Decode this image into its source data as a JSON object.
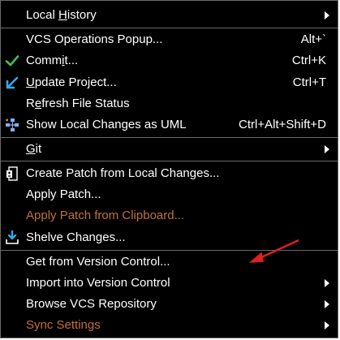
{
  "menu": {
    "local_history": {
      "pre": "Local ",
      "mn": "H",
      "post": "istory"
    },
    "vcs_popup": {
      "label": "VCS Operations Popup...",
      "shortcut": "Alt+`"
    },
    "commit": {
      "pre": "Comm",
      "mn": "i",
      "post": "t...",
      "shortcut": "Ctrl+K"
    },
    "update_project": {
      "pre": "",
      "mn": "U",
      "post": "pdate Project...",
      "shortcut": "Ctrl+T"
    },
    "refresh": {
      "pre": "R",
      "mn": "e",
      "post": "fresh File Status"
    },
    "show_uml": {
      "label": "Show Local Changes as UML",
      "shortcut": "Ctrl+Alt+Shift+D"
    },
    "git": {
      "pre": "",
      "mn": "G",
      "post": "it"
    },
    "create_patch": {
      "label": "Create Patch from Local Changes..."
    },
    "apply_patch": {
      "label": "Apply Patch..."
    },
    "apply_patch_clipboard": {
      "label": "Apply Patch from Clipboard..."
    },
    "shelve": {
      "label": "Shelve Changes..."
    },
    "get_from_vcs": {
      "label": "Get from Version Control..."
    },
    "import_vcs": {
      "label": "Import into Version Control"
    },
    "browse_vcs": {
      "label": "Browse VCS Repository"
    },
    "sync_settings": {
      "label": "Sync Settings"
    }
  },
  "colors": {
    "background": "#000000",
    "text": "#ffffff",
    "disabled_text": "#c2703d",
    "separator": "#6b6b6b",
    "annotation_arrow": "#e02020"
  }
}
